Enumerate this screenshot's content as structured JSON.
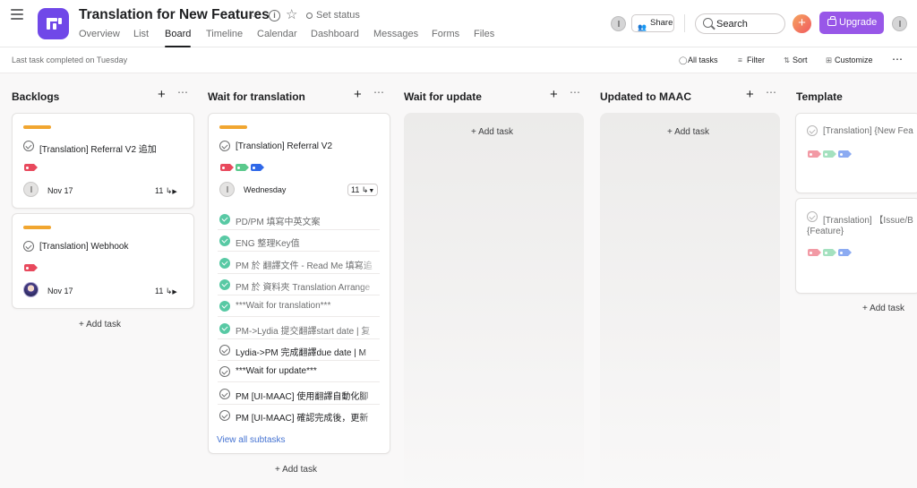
{
  "header": {
    "project_title": "Translation for New Features",
    "set_status": "Set status",
    "tabs": [
      {
        "label": "Overview",
        "active": false
      },
      {
        "label": "List",
        "active": false
      },
      {
        "label": "Board",
        "active": true
      },
      {
        "label": "Timeline",
        "active": false
      },
      {
        "label": "Calendar",
        "active": false
      },
      {
        "label": "Dashboard",
        "active": false
      },
      {
        "label": "Messages",
        "active": false
      },
      {
        "label": "Forms",
        "active": false
      },
      {
        "label": "Files",
        "active": false
      }
    ],
    "share_label": "Share",
    "search_placeholder": "Search",
    "upgrade_label": "Upgrade",
    "icons": [
      "hamburger-icon",
      "project-logo-icon",
      "chevron-down-icon",
      "info-icon",
      "star-icon",
      "status-circle-icon",
      "share-people-icon",
      "search-icon",
      "plus-icon",
      "briefcase-icon"
    ],
    "brand_color": "#7048e8",
    "upgrade_color": "#9857e8"
  },
  "toolbar": {
    "last_completed": "Last task completed on Tuesday",
    "all_tasks": "All tasks",
    "filter": "Filter",
    "sort": "Sort",
    "customize": "Customize"
  },
  "columns": [
    {
      "title": "Backlogs",
      "add_task": "Add task",
      "cards": [
        {
          "title": "[Translation] Referral V2 追加",
          "tags": [
            "red"
          ],
          "due": "Nov 17",
          "subtasks": "11"
        },
        {
          "title": "[Translation] Webhook",
          "tags": [
            "red"
          ],
          "due": "Nov 17",
          "subtasks": "11"
        }
      ]
    },
    {
      "title": "Wait for translation",
      "add_task": "Add task",
      "cards": [
        {
          "title": "[Translation] Referral V2",
          "tags": [
            "red",
            "green",
            "blue"
          ],
          "due": "Wednesday",
          "subtasks": "11",
          "subtask_list": [
            {
              "label": "PD/PM 填寫中英文案",
              "done": true
            },
            {
              "label": "ENG 整理Key值",
              "done": true
            },
            {
              "label": "PM 於 翻譯文件 - Read Me 填寫追",
              "done": true
            },
            {
              "label": "PM 於 資料夾 Translation Arrange",
              "done": true
            },
            {
              "label": "***Wait for translation***",
              "done": true
            },
            {
              "label": "PM->Lydia 提交翻譯start date | 复",
              "done": true
            },
            {
              "label": "Lydia->PM 完成翻譯due date | M",
              "done": false
            },
            {
              "label": "***Wait for update***",
              "done": false
            },
            {
              "label": "PM [UI-MAAC] 使用翻譯自動化腳",
              "done": false
            },
            {
              "label": "PM [UI-MAAC] 確認完成後，更新",
              "done": false
            }
          ],
          "view_all": "View all subtasks"
        }
      ]
    },
    {
      "title": "Wait for update",
      "add_task": "Add task",
      "cards": []
    },
    {
      "title": "Updated to MAAC",
      "add_task": "Add task",
      "cards": []
    },
    {
      "title": "Template",
      "add_task": "Add task",
      "cards": [
        {
          "title": "[Translation] {New Fea",
          "tags": [
            "red",
            "green",
            "blue"
          ]
        },
        {
          "title_line1": "[Translation] 【Issue/B",
          "title_line2": "{Feature}",
          "tags": [
            "red",
            "green",
            "blue"
          ]
        }
      ]
    }
  ],
  "tag_colors": {
    "red": "#e8495d",
    "green": "#5bc98c",
    "blue": "#2f68e8",
    "priority_bar": "#f1a630"
  }
}
